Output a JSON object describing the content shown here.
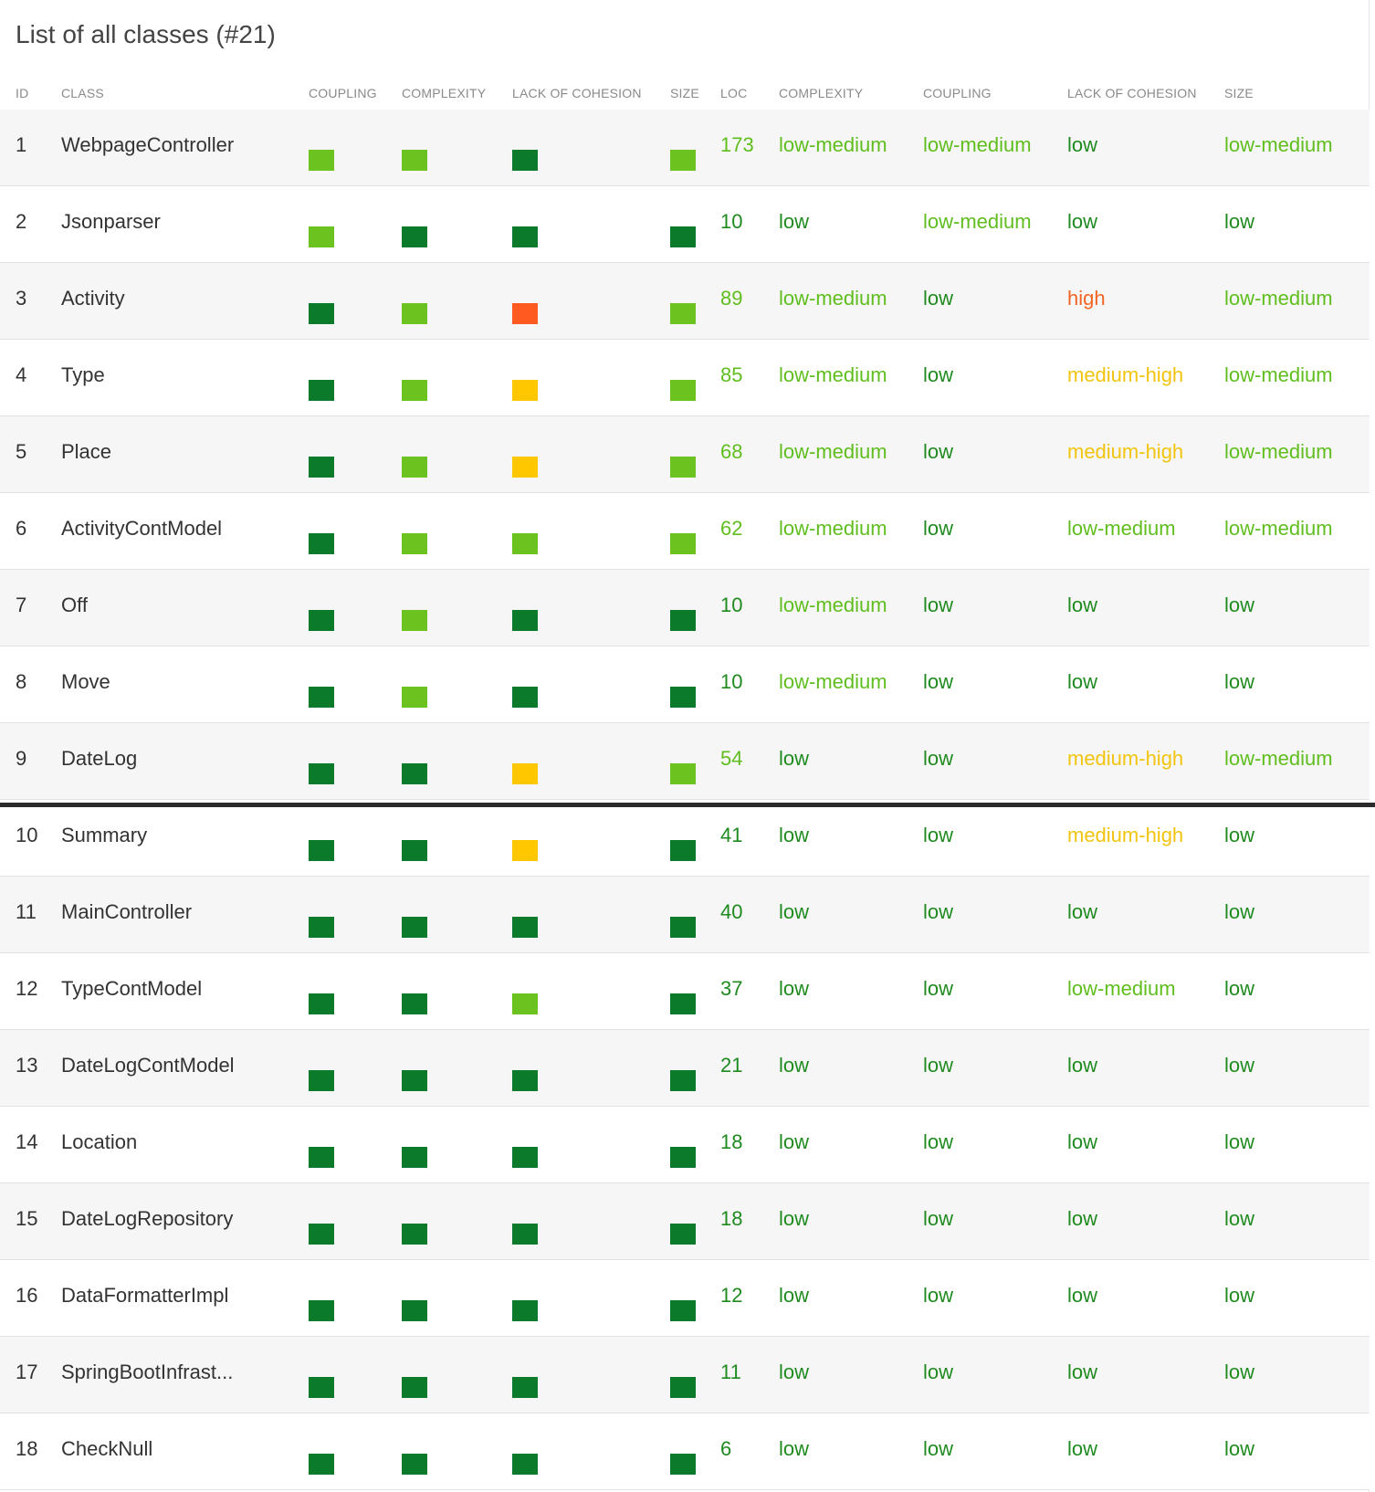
{
  "title": "List of all classes (#21)",
  "headers": [
    "ID",
    "CLASS",
    "COUPLING",
    "COMPLEXITY",
    "LACK OF COHESION",
    "SIZE",
    "LOC",
    "COMPLEXITY",
    "COUPLING",
    "LACK OF COHESION",
    "SIZE"
  ],
  "colors": {
    "low": "#0b7a2a",
    "low-medium": "#6cc21e",
    "medium-high": "#ffc700",
    "high": "#ff5a1f"
  },
  "rows": [
    {
      "id": "1",
      "name": "WebpageController",
      "squares": [
        "low-medium",
        "low-medium",
        "low",
        "low-medium"
      ],
      "loc": "173",
      "complexity": "low-medium",
      "coupling": "low-medium",
      "cohesion": "low",
      "size": "low-medium"
    },
    {
      "id": "2",
      "name": "Jsonparser",
      "squares": [
        "low-medium",
        "low",
        "low",
        "low"
      ],
      "loc": "10",
      "complexity": "low",
      "coupling": "low-medium",
      "cohesion": "low",
      "size": "low"
    },
    {
      "id": "3",
      "name": "Activity",
      "squares": [
        "low",
        "low-medium",
        "high",
        "low-medium"
      ],
      "loc": "89",
      "complexity": "low-medium",
      "coupling": "low",
      "cohesion": "high",
      "size": "low-medium"
    },
    {
      "id": "4",
      "name": "Type",
      "squares": [
        "low",
        "low-medium",
        "medium-high",
        "low-medium"
      ],
      "loc": "85",
      "complexity": "low-medium",
      "coupling": "low",
      "cohesion": "medium-high",
      "size": "low-medium"
    },
    {
      "id": "5",
      "name": "Place",
      "squares": [
        "low",
        "low-medium",
        "medium-high",
        "low-medium"
      ],
      "loc": "68",
      "complexity": "low-medium",
      "coupling": "low",
      "cohesion": "medium-high",
      "size": "low-medium"
    },
    {
      "id": "6",
      "name": "ActivityContModel",
      "squares": [
        "low",
        "low-medium",
        "low-medium",
        "low-medium"
      ],
      "loc": "62",
      "complexity": "low-medium",
      "coupling": "low",
      "cohesion": "low-medium",
      "size": "low-medium"
    },
    {
      "id": "7",
      "name": "Off",
      "squares": [
        "low",
        "low-medium",
        "low",
        "low"
      ],
      "loc": "10",
      "complexity": "low-medium",
      "coupling": "low",
      "cohesion": "low",
      "size": "low"
    },
    {
      "id": "8",
      "name": "Move",
      "squares": [
        "low",
        "low-medium",
        "low",
        "low"
      ],
      "loc": "10",
      "complexity": "low-medium",
      "coupling": "low",
      "cohesion": "low",
      "size": "low"
    },
    {
      "id": "9",
      "name": "DateLog",
      "squares": [
        "low",
        "low",
        "medium-high",
        "low-medium"
      ],
      "loc": "54",
      "complexity": "low",
      "coupling": "low",
      "cohesion": "medium-high",
      "size": "low-medium"
    },
    {
      "id": "10",
      "name": "Summary",
      "squares": [
        "low",
        "low",
        "medium-high",
        "low"
      ],
      "loc": "41",
      "complexity": "low",
      "coupling": "low",
      "cohesion": "medium-high",
      "size": "low"
    },
    {
      "id": "11",
      "name": "MainController",
      "squares": [
        "low",
        "low",
        "low",
        "low"
      ],
      "loc": "40",
      "complexity": "low",
      "coupling": "low",
      "cohesion": "low",
      "size": "low"
    },
    {
      "id": "12",
      "name": "TypeContModel",
      "squares": [
        "low",
        "low",
        "low-medium",
        "low"
      ],
      "loc": "37",
      "complexity": "low",
      "coupling": "low",
      "cohesion": "low-medium",
      "size": "low"
    },
    {
      "id": "13",
      "name": "DateLogContModel",
      "squares": [
        "low",
        "low",
        "low",
        "low"
      ],
      "loc": "21",
      "complexity": "low",
      "coupling": "low",
      "cohesion": "low",
      "size": "low"
    },
    {
      "id": "14",
      "name": "Location",
      "squares": [
        "low",
        "low",
        "low",
        "low"
      ],
      "loc": "18",
      "complexity": "low",
      "coupling": "low",
      "cohesion": "low",
      "size": "low"
    },
    {
      "id": "15",
      "name": "DateLogRepository",
      "squares": [
        "low",
        "low",
        "low",
        "low"
      ],
      "loc": "18",
      "complexity": "low",
      "coupling": "low",
      "cohesion": "low",
      "size": "low"
    },
    {
      "id": "16",
      "name": "DataFormatterImpl",
      "squares": [
        "low",
        "low",
        "low",
        "low"
      ],
      "loc": "12",
      "complexity": "low",
      "coupling": "low",
      "cohesion": "low",
      "size": "low"
    },
    {
      "id": "17",
      "name": "SpringBootInfrast...",
      "squares": [
        "low",
        "low",
        "low",
        "low"
      ],
      "loc": "11",
      "complexity": "low",
      "coupling": "low",
      "cohesion": "low",
      "size": "low"
    },
    {
      "id": "18",
      "name": "CheckNull",
      "squares": [
        "low",
        "low",
        "low",
        "low"
      ],
      "loc": "6",
      "complexity": "low",
      "coupling": "low",
      "cohesion": "low",
      "size": "low"
    }
  ]
}
